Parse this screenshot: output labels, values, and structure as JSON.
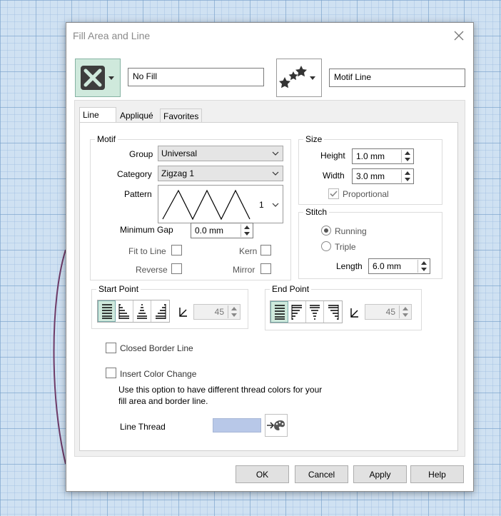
{
  "dialog": {
    "title": "Fill Area and Line",
    "fill_type": "No Fill",
    "line_type": "Motif Line"
  },
  "tabs": [
    {
      "label": "Line",
      "active": true
    },
    {
      "label": "Appliqué",
      "active": false
    },
    {
      "label": "Favorites",
      "active": false
    }
  ],
  "motif": {
    "label": "Motif",
    "group_label": "Group",
    "group_value": "Universal",
    "category_label": "Category",
    "category_value": "Zigzag 1",
    "pattern_label": "Pattern",
    "pattern_number": "1",
    "min_gap_label": "Minimum Gap",
    "min_gap_value": "0.0 mm",
    "fit_to_line": "Fit to Line",
    "kern": "Kern",
    "reverse": "Reverse",
    "mirror": "Mirror"
  },
  "size": {
    "label": "Size",
    "height_label": "Height",
    "height_value": "1.0 mm",
    "width_label": "Width",
    "width_value": "3.0 mm",
    "proportional": "Proportional",
    "proportional_checked": true
  },
  "stitch": {
    "label": "Stitch",
    "running": "Running",
    "triple": "Triple",
    "selected": "Running",
    "length_label": "Length",
    "length_value": "6.0 mm"
  },
  "start_point": {
    "label": "Start Point",
    "angle": "45"
  },
  "end_point": {
    "label": "End Point",
    "angle": "45"
  },
  "closed_border": "Closed Border Line",
  "insert_color_change": "Insert Color Change",
  "help_text_1": "Use this option to have different thread colors for your",
  "help_text_2": "fill area and border line.",
  "line_thread_label": "Line Thread",
  "line_thread_color": "#b8c8e8",
  "buttons": {
    "ok": "OK",
    "cancel": "Cancel",
    "apply": "Apply",
    "help": "Help"
  },
  "icons": {
    "fill": "no-fill-x-icon",
    "line": "motif-stars-icon",
    "thread": "thread-palette-icon",
    "close": "close-icon",
    "angle": "angle-icon"
  }
}
